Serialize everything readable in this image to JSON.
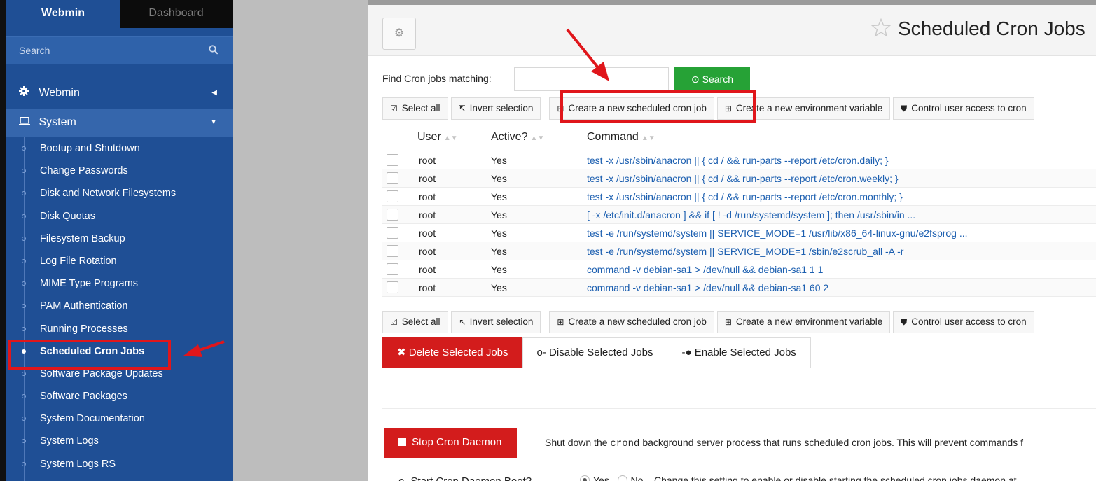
{
  "sidebar": {
    "tabs": [
      "Webmin",
      "Dashboard"
    ],
    "search_placeholder": "Search",
    "categories": [
      {
        "label": "Webmin",
        "icon": "gear-icon"
      },
      {
        "label": "System",
        "icon": "laptop-icon"
      }
    ],
    "items": [
      "Bootup and Shutdown",
      "Change Passwords",
      "Disk and Network Filesystems",
      "Disk Quotas",
      "Filesystem Backup",
      "Log File Rotation",
      "MIME Type Programs",
      "PAM Authentication",
      "Running Processes",
      "Scheduled Cron Jobs",
      "Software Package Updates",
      "Software Packages",
      "System Documentation",
      "System Logs",
      "System Logs RS"
    ],
    "active_item": "Scheduled Cron Jobs"
  },
  "main": {
    "title": "Scheduled Cron Jobs",
    "find_label": "Find Cron jobs matching:",
    "find_value": "",
    "search_button": "Search",
    "toolbar": {
      "select_all": "Select all",
      "invert_selection": "Invert selection",
      "create_job": "Create a new scheduled cron job",
      "create_env": "Create a new environment variable",
      "control_access": "Control user access to cron"
    },
    "table": {
      "headers": [
        "User",
        "Active?",
        "Command"
      ],
      "rows": [
        {
          "user": "root",
          "active": "Yes",
          "command": "test -x /usr/sbin/anacron || { cd / && run-parts --report /etc/cron.daily; }"
        },
        {
          "user": "root",
          "active": "Yes",
          "command": "test -x /usr/sbin/anacron || { cd / && run-parts --report /etc/cron.weekly; }"
        },
        {
          "user": "root",
          "active": "Yes",
          "command": "test -x /usr/sbin/anacron || { cd / && run-parts --report /etc/cron.monthly; }"
        },
        {
          "user": "root",
          "active": "Yes",
          "command": "[ -x /etc/init.d/anacron ] && if [ ! -d /run/systemd/system ]; then /usr/sbin/in ..."
        },
        {
          "user": "root",
          "active": "Yes",
          "command": "test -e /run/systemd/system || SERVICE_MODE=1 /usr/lib/x86_64-linux-gnu/e2fsprog ..."
        },
        {
          "user": "root",
          "active": "Yes",
          "command": "test -e /run/systemd/system || SERVICE_MODE=1 /sbin/e2scrub_all -A -r"
        },
        {
          "user": "root",
          "active": "Yes",
          "command": "command -v debian-sa1 > /dev/null && debian-sa1 1 1"
        },
        {
          "user": "root",
          "active": "Yes",
          "command": "command -v debian-sa1 > /dev/null && debian-sa1 60 2"
        }
      ]
    },
    "actions": {
      "delete": "Delete Selected Jobs",
      "disable": "Disable Selected Jobs",
      "enable": "Enable Selected Jobs"
    },
    "daemon": {
      "stop_button": "Stop Cron Daemon",
      "stop_desc_pre": "Shut down the",
      "stop_desc_code": "crond",
      "stop_desc_post": "background server process that runs scheduled cron jobs. This will prevent commands f",
      "boot_button": "Start Cron Daemon Boot?",
      "yes_label": "Yes",
      "no_label": "No",
      "boot_selected": "Yes",
      "boot_desc": "Change this setting to enable or disable starting the scheduled cron jobs daemon at"
    }
  },
  "colors": {
    "sidebar_bg": "#1f4f95",
    "accent_green": "#26a236",
    "danger_red": "#d31c1c",
    "link_blue": "#1c5fb0",
    "annotation_red": "#e0161b"
  }
}
